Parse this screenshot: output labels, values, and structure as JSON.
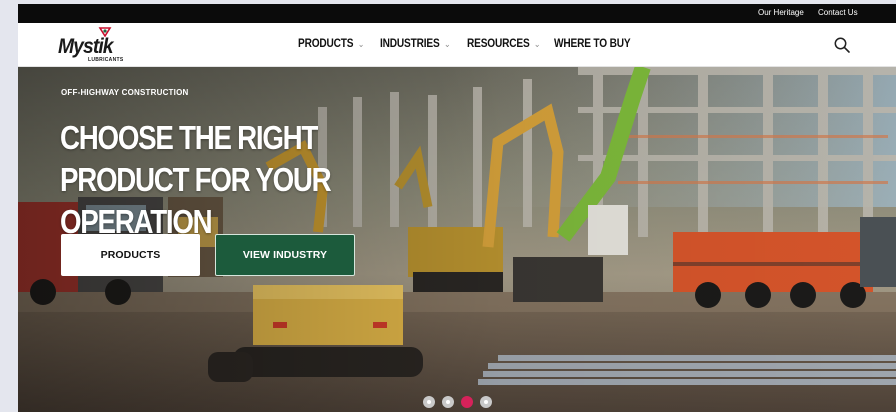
{
  "utility_nav": {
    "heritage": "Our Heritage",
    "contact": "Contact Us"
  },
  "logo": {
    "name": "Mystik",
    "tagline": "LUBRICANTS"
  },
  "main_nav": {
    "products": "PRODUCTS",
    "industries": "INDUSTRIES",
    "resources": "RESOURCES",
    "where_to_buy": "WHERE TO BUY"
  },
  "hero": {
    "eyebrow": "OFF-HIGHWAY CONSTRUCTION",
    "headline": "CHOOSE THE RIGHT PRODUCT FOR YOUR OPERATION",
    "primary_button": "PRODUCTS",
    "secondary_button": "VIEW INDUSTRY",
    "slides": 4,
    "active_slide": 3
  },
  "colors": {
    "accent_green": "#1c5b3c",
    "active_dot": "#d6225a",
    "top_bar": "#0b0b0b"
  },
  "icons": [
    "search-icon",
    "chevron-down-icon",
    "logo-drop-icon"
  ]
}
